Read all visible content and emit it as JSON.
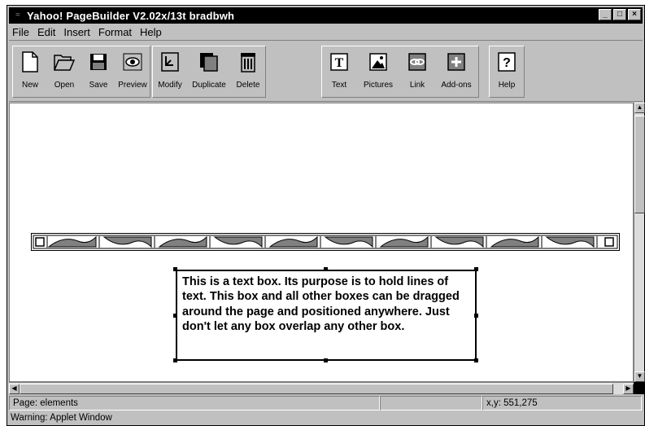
{
  "window": {
    "title": "Yahoo! PageBuilder V2.02x/13t bradbwh",
    "controls": {
      "minimize": "_",
      "maximize": "□",
      "close": "×"
    }
  },
  "menu": [
    "File",
    "Edit",
    "Insert",
    "Format",
    "Help"
  ],
  "toolbar": {
    "file_group": [
      {
        "label": "New",
        "icon": "new-page-icon"
      },
      {
        "label": "Open",
        "icon": "folder-icon"
      },
      {
        "label": "Save",
        "icon": "floppy-icon"
      },
      {
        "label": "Preview",
        "icon": "eye-icon"
      }
    ],
    "edit_group": [
      {
        "label": "Modify",
        "icon": "modify-icon"
      },
      {
        "label": "Duplicate",
        "icon": "duplicate-icon"
      },
      {
        "label": "Delete",
        "icon": "trash-icon"
      }
    ],
    "insert_group": [
      {
        "label": "Text",
        "icon": "text-t-icon"
      },
      {
        "label": "Pictures",
        "icon": "picture-icon"
      },
      {
        "label": "Link",
        "icon": "link-icon"
      },
      {
        "label": "Add-ons",
        "icon": "plus-icon"
      }
    ],
    "help_group": [
      {
        "label": "Help",
        "icon": "question-icon"
      }
    ]
  },
  "canvas": {
    "textbox": "This is a text box. Its purpose is to hold lines of text. This box and all other boxes can be dragged around the page and positioned anywhere. Just don't let any box overlap any other box."
  },
  "status": {
    "page": "Page: elements",
    "middle": "",
    "coords": "x,y: 551,275"
  },
  "warning": "Warning: Applet Window"
}
